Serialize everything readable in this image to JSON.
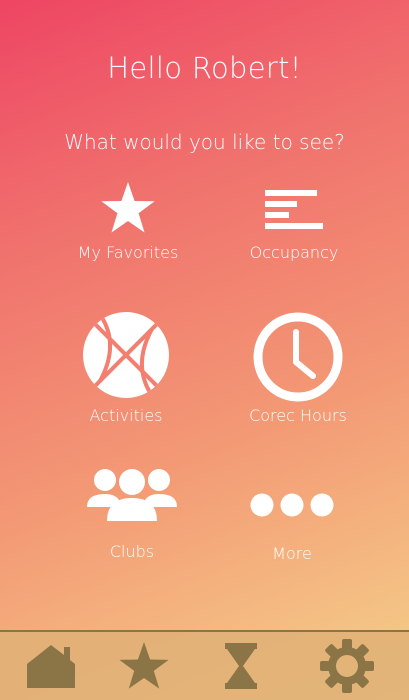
{
  "header": {
    "greeting": "Hello Robert!",
    "prompt": "What would you like to see?"
  },
  "tiles": [
    {
      "label": "My Favorites",
      "icon": "star-icon"
    },
    {
      "label": "Occupancy",
      "icon": "bars-icon"
    },
    {
      "label": "Activities",
      "icon": "basketball-icon"
    },
    {
      "label": "Corec Hours",
      "icon": "clock-icon"
    },
    {
      "label": "Clubs",
      "icon": "group-icon"
    },
    {
      "label": "More",
      "icon": "dots-icon"
    }
  ],
  "tabbar": {
    "tabs": [
      {
        "icon": "home-icon"
      },
      {
        "icon": "star-icon"
      },
      {
        "icon": "hourglass-icon"
      },
      {
        "icon": "gear-icon"
      }
    ]
  },
  "colors": {
    "gradient_start": "#ee4563",
    "gradient_end": "#f5d28a",
    "tab_icon": "#8b7446",
    "text": "#ffffff"
  }
}
